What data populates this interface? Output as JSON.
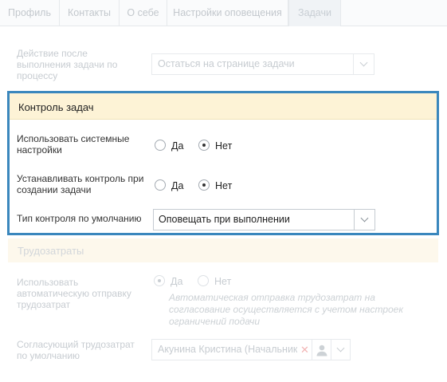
{
  "tabs": [
    {
      "label": "Профиль"
    },
    {
      "label": "Контакты"
    },
    {
      "label": "О себе"
    },
    {
      "label": "Настройки оповещения"
    },
    {
      "label": "Задачи"
    }
  ],
  "after_action": {
    "label": "Действие после выполнения задачи по процессу",
    "value": "Остаться на странице задачи"
  },
  "task_control": {
    "title": "Контроль задач",
    "use_system_settings": {
      "label": "Использовать системные настройки",
      "yes": "Да",
      "no": "Нет",
      "selected": "no"
    },
    "set_control_on_create": {
      "label": "Устанавливать контроль при создании задачи",
      "yes": "Да",
      "no": "Нет",
      "selected": "no"
    },
    "default_control_type": {
      "label": "Тип контроля по умолчанию",
      "value": "Оповещать при выполнении"
    }
  },
  "labor_costs": {
    "title": "Трудозатраты",
    "auto_send": {
      "label": "Использовать автоматическую отправку трудозатрат",
      "yes": "Да",
      "no": "Нет",
      "selected": "yes"
    },
    "hint": "Автоматическая отправка трудозатрат на согласование осуществляется с учетом настроек ограничений подачи",
    "approver": {
      "label": "Согласующий трудозатрат по умолчанию",
      "value": "Акунина Кристина (Начальник к"
    }
  },
  "colors": {
    "accent_border": "#3a87bd",
    "panel_header_bg": "#fdf3d6",
    "remove_icon": "#e07070"
  }
}
